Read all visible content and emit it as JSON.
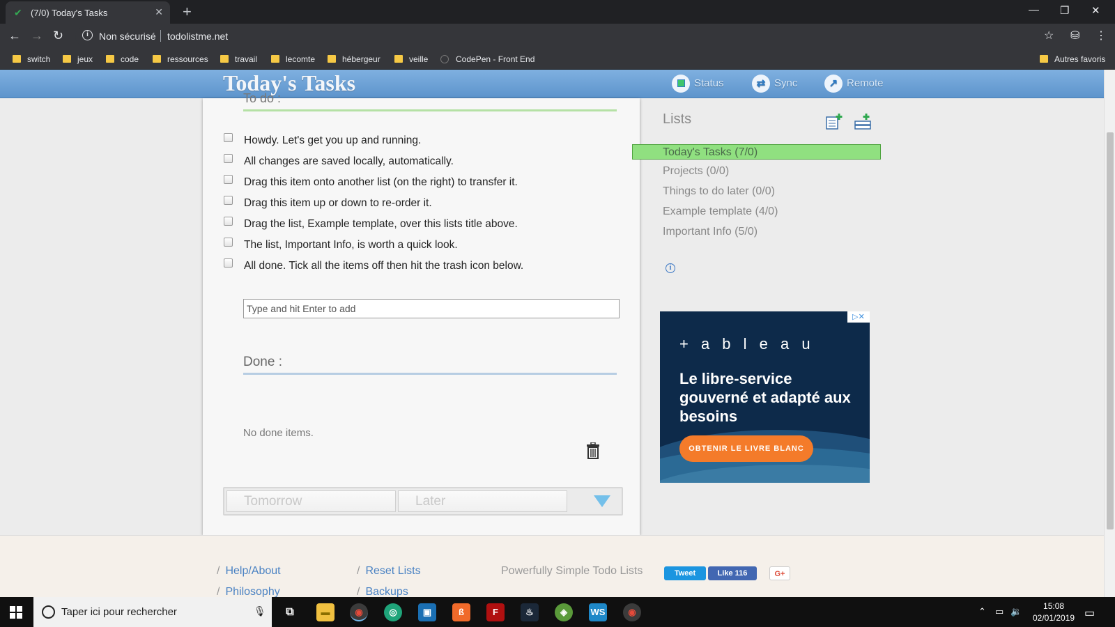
{
  "browser": {
    "tab_title": "(7/0) Today's Tasks",
    "security_label": "Non sécurisé",
    "url": "todolistme.net",
    "bookmarks": [
      "switch",
      "jeux",
      "code",
      "ressources",
      "travail",
      "lecomte",
      "hébergeur",
      "veille",
      "CodePen - Front End"
    ],
    "other_bookmarks": "Autres favoris"
  },
  "header": {
    "title": "Today's Tasks",
    "buttons": [
      {
        "label": "Status",
        "icon": "status-icon"
      },
      {
        "label": "Sync",
        "icon": "sync-icon"
      },
      {
        "label": "Remote",
        "icon": "remote-icon"
      }
    ]
  },
  "todo": {
    "heading": "To do :",
    "items": [
      "Howdy. Let's get you up and running.",
      "All changes are saved locally, automatically.",
      "Drag this item onto another list (on the right) to transfer it.",
      "Drag this item up or down to re-order it.",
      "Drag the list, Example template, over this lists title above.",
      "The list, Important Info, is worth a quick look.",
      "All done. Tick all the items off then hit the trash icon below."
    ],
    "add_placeholder": "Type and hit Enter to add"
  },
  "done": {
    "heading": "Done :",
    "empty_text": "No done items."
  },
  "move": {
    "tomorrow": "Tomorrow",
    "later": "Later"
  },
  "lists": {
    "title": "Lists",
    "items": [
      "Today's Tasks (7/0)",
      "Projects (0/0)",
      "Things to do later (0/0)",
      "Example template (4/0)",
      "Important Info (5/0)"
    ]
  },
  "ad": {
    "brand": "+ a b l e a u",
    "headline": "Le libre-service gouverné et adapté aux besoins",
    "cta": "OBTENIR LE LIVRE BLANC"
  },
  "footer": {
    "links": [
      "Help/About",
      "Philosophy",
      "Reset Lists",
      "Backups"
    ],
    "tagline": "Powerfully Simple Todo Lists",
    "tweet": "Tweet",
    "like": "Like 116",
    "gplus": "G+"
  },
  "taskbar": {
    "search_placeholder": "Taper ici pour rechercher",
    "time": "15:08",
    "date": "02/01/2019"
  },
  "colors": {
    "header_blue": "#5d94cc",
    "active_list_green": "#90e080",
    "link_blue": "#4a82c3",
    "ad_navy": "#0d2a4a",
    "ad_cta_orange": "#f47b2a"
  }
}
